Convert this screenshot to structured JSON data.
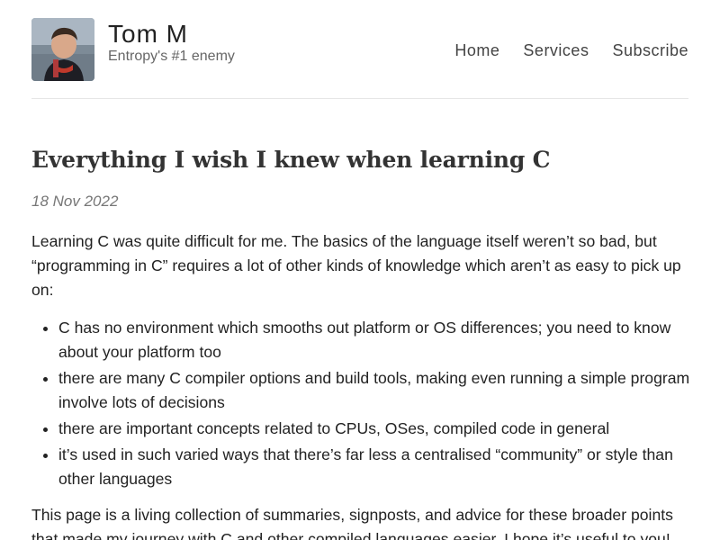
{
  "header": {
    "site_title": "Tom M",
    "tagline": "Entropy's #1 enemy",
    "avatar_alt": "Tom M avatar",
    "nav": [
      {
        "label": "Home"
      },
      {
        "label": "Services"
      },
      {
        "label": "Subscribe"
      }
    ]
  },
  "post": {
    "title": "Everything I wish I knew when learning C",
    "date": "18 Nov 2022",
    "intro": "Learning C was quite difficult for me. The basics of the language itself weren’t so bad, but “programming in C” requires a lot of other kinds of knowledge which aren’t as easy to pick up on:",
    "points": [
      "C has no environment which smooths out platform or OS differences; you need to know about your platform too",
      "there are many C compiler options and build tools, making even running a simple program involve lots of decisions",
      "there are important concepts related to CPUs, OSes, compiled code in general",
      "it’s used in such varied ways that there’s far less a centralised “community” or style than other languages"
    ],
    "outro": "This page is a living collection of summaries, signposts, and advice for these broader points that made my journey with C and other compiled languages easier. I hope it’s useful to you!"
  },
  "colors": {
    "text": "#222222",
    "muted": "#666666",
    "divider": "#e6e6e6"
  }
}
